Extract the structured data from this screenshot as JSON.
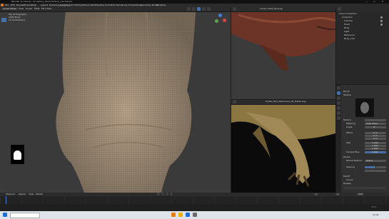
{
  "window": {
    "title": "Blender [C:\\Users\\...\\Sculpting_Head_Texture_v12.blend]",
    "controls": [
      "—",
      "□",
      "✕"
    ]
  },
  "menubar": {
    "items": [
      "File",
      "Edit",
      "Render",
      "Window",
      "Help"
    ],
    "workspaces": [
      "Layout",
      "Modeling",
      "Sculpting",
      "UV Editing",
      "Texture Paint",
      "Shading",
      "Animation",
      "Rendering",
      "Compositing",
      "Geometry Nodes",
      "Scripting"
    ],
    "active_workspace": "Sculpting"
  },
  "viewport_left": {
    "mode": "Sculpt Mode",
    "overlay_lines": [
      "Top Orthographic",
      "(295) Body",
      "10 Centimeters"
    ],
    "buttons": [
      "View",
      "Sculpt",
      "Mask",
      "Face Sets"
    ]
  },
  "viewport_right_top": {
    "title": "Sculpt_Head_Ref.png"
  },
  "image_editor": {
    "title": "M_Rex_Skin_Reference_02_Detail.png"
  },
  "outliner": {
    "title": "Scene Collection",
    "rows": [
      "Collection",
      "Camera",
      "Head",
      "Body",
      "Light",
      "Reference",
      "Body_Low"
    ]
  },
  "properties": {
    "panels": [
      "Brush",
      "Texture",
      "Mapping",
      "Angle",
      "Offset",
      "Size",
      "Sample Bias",
      "Stroke",
      "Stroke Method",
      "Spacing",
      "Falloff",
      "Cursor",
      "Display"
    ],
    "mapping_value": "View Plane",
    "stroke_method_value": "Space",
    "values": [
      "0°",
      "0 m",
      "0 m",
      "0 m",
      "1.000",
      "1.000",
      "1.000",
      "0.000"
    ]
  },
  "timeline": {
    "items": [
      "Playback",
      "Keying",
      "View",
      "Marker"
    ],
    "frame": "1",
    "start": "1",
    "end": "250"
  },
  "statusbar": {
    "text": "3.5.1"
  },
  "taskbar": {
    "time": "10:42"
  },
  "colors": {
    "accent": "#4a6fa5",
    "skin": "#b09a82",
    "header": "#2b2b2b",
    "panel": "#303030"
  }
}
